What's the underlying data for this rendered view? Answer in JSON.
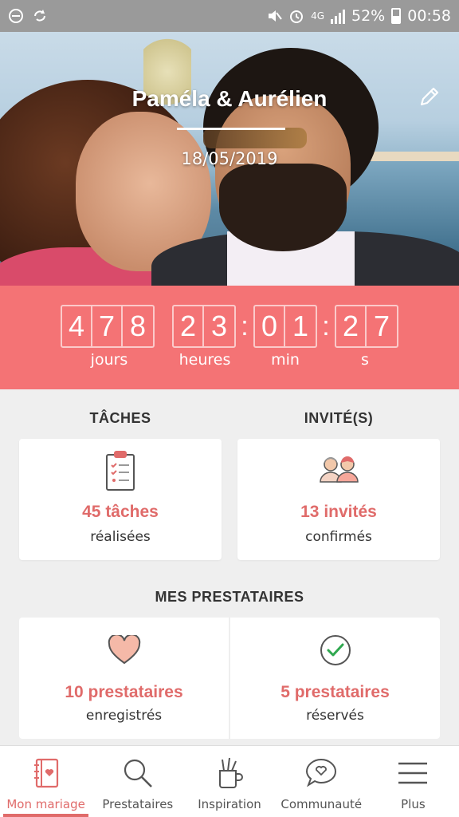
{
  "status_bar": {
    "network": "4G",
    "battery": "52%",
    "time": "00:58"
  },
  "hero": {
    "names": "Paméla & Aurélien",
    "date": "18/05/2019"
  },
  "countdown": {
    "days": [
      "4",
      "7",
      "8"
    ],
    "hours": [
      "2",
      "3"
    ],
    "minutes": [
      "0",
      "1"
    ],
    "seconds": [
      "2",
      "7"
    ],
    "labels": {
      "days": "jours",
      "hours": "heures",
      "minutes": "min",
      "seconds": "s"
    },
    "separator": ":"
  },
  "tasks": {
    "heading": "TÂCHES",
    "count": "45 tâches",
    "caption": "réalisées"
  },
  "guests": {
    "heading": "INVITÉ(S)",
    "count": "13 invités",
    "caption": "confirmés"
  },
  "vendors": {
    "heading": "MES PRESTATAIRES",
    "saved_count": "10 prestataires",
    "saved_caption": "enregistrés",
    "booked_count": "5 prestataires",
    "booked_caption": "réservés"
  },
  "bottom_nav": {
    "items": [
      {
        "label": "Mon mariage",
        "icon": "notebook-icon",
        "active": true
      },
      {
        "label": "Prestataires",
        "icon": "search-icon",
        "active": false
      },
      {
        "label": "Inspiration",
        "icon": "pencil-cup-icon",
        "active": false
      },
      {
        "label": "Communauté",
        "icon": "heart-chat-icon",
        "active": false
      },
      {
        "label": "Plus",
        "icon": "menu-icon",
        "active": false
      }
    ]
  },
  "colors": {
    "accent": "#f47375",
    "accent_text": "#e06b6a",
    "status_bar": "#9a9a9a",
    "background": "#efefef"
  }
}
